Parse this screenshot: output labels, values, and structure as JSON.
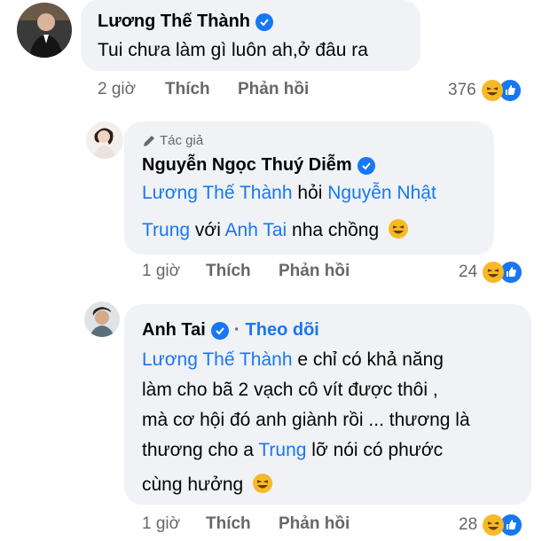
{
  "comments": [
    {
      "name": "Lương Thế Thành",
      "line1": "Tui chưa làm gì luôn ah,ở đâu ra",
      "time": "2 giờ",
      "like": "Thích",
      "reply": "Phản hồi",
      "reactions": "376"
    },
    {
      "author_tag": "Tác giả",
      "name": "Nguyễn Ngọc Thuý Diễm",
      "mention1": "Lương Thế Thành",
      "text1": " hỏi ",
      "mention2a": "Nguyễn Nhật",
      "mention2b": "Trung",
      "text2": " với ",
      "mention3": "Anh Tai",
      "text3": " nha chồng",
      "time": "1 giờ",
      "like": "Thích",
      "reply": "Phản hồi",
      "reactions": "24"
    },
    {
      "name": "Anh Tai",
      "follow": "Theo dõi",
      "mention1": "Lương Thế Thành",
      "text1": " e chỉ có khả năng",
      "line2": "làm cho bã 2 vạch cô vít được thôi ,",
      "line3": "mà cơ hội đó anh giành rồi ... thương là",
      "line4a": "thương cho a ",
      "mention2": "Trung",
      "line4b": " lỡ nói có phước",
      "line5": "cùng hưởng",
      "time": "1 giờ",
      "like": "Thích",
      "reply": "Phản hồi",
      "reactions": "28"
    }
  ]
}
